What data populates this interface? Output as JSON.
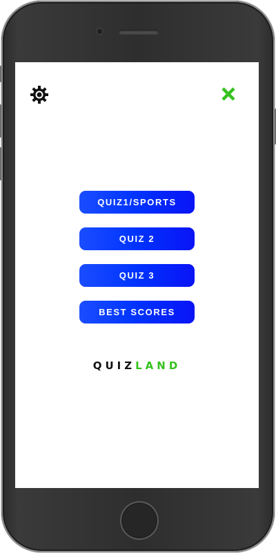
{
  "header": {
    "settings_icon": "gear-icon",
    "close_icon": "close-icon"
  },
  "menu": {
    "items": [
      {
        "label": "QUIZ1/SPORTS"
      },
      {
        "label": "QUIZ 2"
      },
      {
        "label": "QUIZ 3"
      },
      {
        "label": "BEST SCORES"
      }
    ]
  },
  "logo": {
    "part1": "QUIZ",
    "part2": "LAND"
  },
  "colors": {
    "button": "#0033ff",
    "accent": "#35c21e",
    "logo_text": "#111111",
    "device": "#2e2e2e"
  }
}
